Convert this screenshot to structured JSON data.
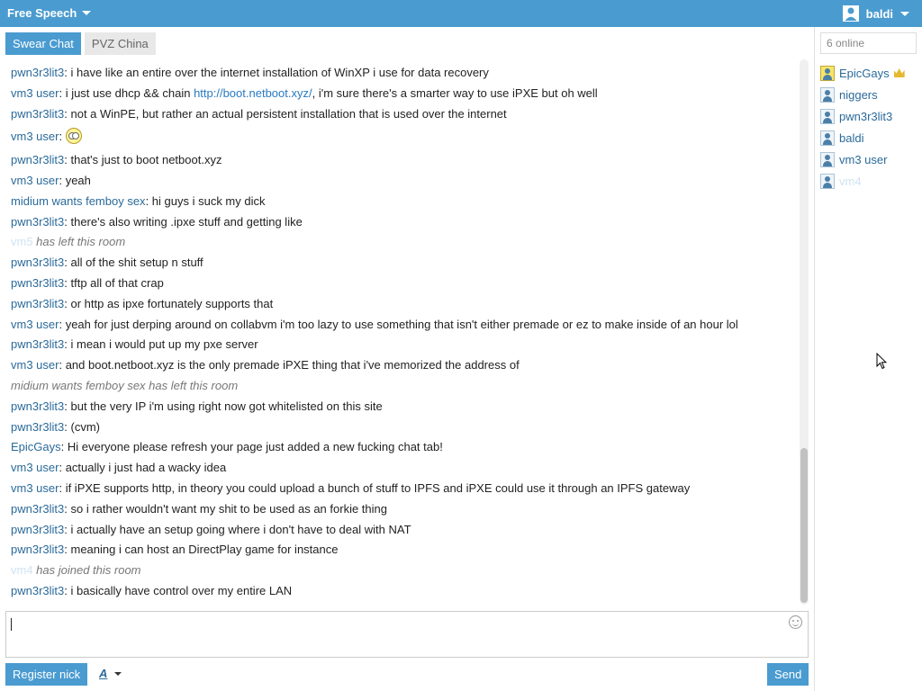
{
  "topbar": {
    "room_name": "Free Speech",
    "username": "baldi"
  },
  "tabs": [
    {
      "label": "Swear Chat",
      "active": true
    },
    {
      "label": "PVZ China",
      "active": false
    }
  ],
  "messages": [
    {
      "nick": "pwn3r3lit3",
      "text": ": i have like an entire over the internet installation of WinXP i use for data recovery"
    },
    {
      "nick": "vm3 user",
      "text": ": i just use dhcp && chain ",
      "link": "http://boot.netboot.xyz/",
      "text_after": ", i'm sure there's a smarter way to use iPXE but oh well"
    },
    {
      "nick": "pwn3r3lit3",
      "text": ": not a WinPE, but rather an actual persistent installation that is used over the internet"
    },
    {
      "nick": "vm3 user",
      "text": ": ",
      "emoji": "dizzy-face-emoji"
    },
    {
      "nick": "pwn3r3lit3",
      "text": ": that's just to boot netboot.xyz"
    },
    {
      "nick": "vm3 user",
      "text": ": yeah"
    },
    {
      "nick": "midium wants femboy sex",
      "text": ": hi guys i suck my dick"
    },
    {
      "nick": "pwn3r3lit3",
      "text": ": there's also writing .ipxe stuff and getting like"
    },
    {
      "nick": "vm5",
      "text": " has left this room",
      "system": true,
      "faint": true
    },
    {
      "nick": "pwn3r3lit3",
      "text": ": all of the shit setup n stuff"
    },
    {
      "nick": "pwn3r3lit3",
      "text": ": tftp all of that crap"
    },
    {
      "nick": "pwn3r3lit3",
      "text": ": or http as ipxe fortunately supports that"
    },
    {
      "nick": "vm3 user",
      "text": ": yeah for just derping around on collabvm i'm too lazy to use something that isn't either premade or ez to make inside of an hour lol"
    },
    {
      "nick": "pwn3r3lit3",
      "text": ": i mean i would put up my pxe server"
    },
    {
      "nick": "vm3 user",
      "text": ": and boot.netboot.xyz is the only premade iPXE thing that i've memorized the address of"
    },
    {
      "nick": "",
      "text": "midium wants femboy sex has left this room",
      "system": true
    },
    {
      "nick": "pwn3r3lit3",
      "text": ": but the very IP i'm using right now got whitelisted on this site"
    },
    {
      "nick": "pwn3r3lit3",
      "text": ": (cvm)"
    },
    {
      "nick": "EpicGays",
      "text": ": Hi everyone please refresh your page just added a new fucking chat tab!"
    },
    {
      "nick": "vm3 user",
      "text": ": actually i just had a wacky idea"
    },
    {
      "nick": "vm3 user",
      "text": ": if iPXE supports http, in theory you could upload a bunch of stuff to IPFS and iPXE could use it through an IPFS gateway"
    },
    {
      "nick": "pwn3r3lit3",
      "text": ": so i rather wouldn't want my shit to be used as an forkie thing"
    },
    {
      "nick": "pwn3r3lit3",
      "text": ": i actually have an setup going where i don't have to deal with NAT"
    },
    {
      "nick": "pwn3r3lit3",
      "text": ": meaning i can host an DirectPlay game for instance"
    },
    {
      "nick": "vm4",
      "text": " has joined this room",
      "system": true,
      "faint": true
    },
    {
      "nick": "pwn3r3lit3",
      "text": ": i basically have control over my entire LAN"
    }
  ],
  "composer": {
    "value": ""
  },
  "buttons": {
    "register": "Register nick",
    "send": "Send",
    "format": "A"
  },
  "sidebar": {
    "online_count": "6 online",
    "users": [
      {
        "name": "EpicGays",
        "owner": true
      },
      {
        "name": "niggers"
      },
      {
        "name": "pwn3r3lit3"
      },
      {
        "name": "baldi"
      },
      {
        "name": "vm3 user"
      },
      {
        "name": "vm4",
        "faint": true
      }
    ]
  },
  "colors": {
    "accent": "#4a9bd0",
    "nick": "#2a6a9a"
  }
}
